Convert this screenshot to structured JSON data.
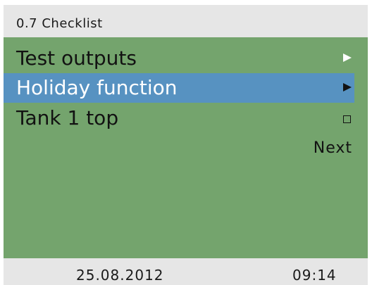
{
  "header": {
    "title": "0.7 Checklist"
  },
  "menu": {
    "items": [
      {
        "label": "Test outputs",
        "icon": "arrow-right-icon",
        "selected": false
      },
      {
        "label": "Holiday function",
        "icon": "arrow-right-icon",
        "selected": true
      },
      {
        "label": "Tank 1 top",
        "icon": "checkbox-unchecked-icon",
        "selected": false
      }
    ],
    "next_label": "Next"
  },
  "status": {
    "date": "25.08.2012",
    "time": "09:14"
  },
  "colors": {
    "background_green": "#74a46d",
    "selection_blue": "#5792c1",
    "bar_grey": "#e6e6e6"
  }
}
